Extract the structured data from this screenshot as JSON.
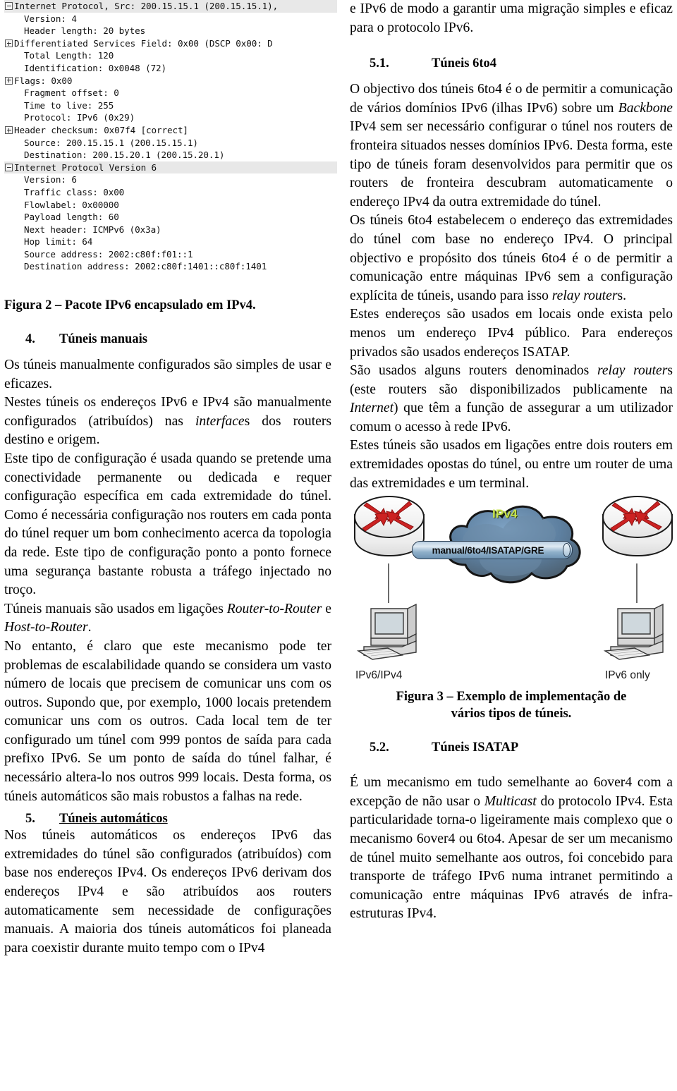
{
  "left_column": {
    "capture_figure": {
      "name": "wireshark-packet-detail",
      "rows": [
        {
          "icon": "minus-box",
          "indent": 0,
          "selected": true,
          "text": "Internet Protocol, Src: 200.15.15.1 (200.15.15.1),"
        },
        {
          "icon": "none",
          "indent": 1,
          "selected": false,
          "text": "Version: 4"
        },
        {
          "icon": "none",
          "indent": 1,
          "selected": false,
          "text": "Header length: 20 bytes"
        },
        {
          "icon": "plus-box",
          "indent": 0,
          "selected": false,
          "text": "Differentiated Services Field: 0x00 (DSCP 0x00: D"
        },
        {
          "icon": "none",
          "indent": 1,
          "selected": false,
          "text": "Total Length: 120"
        },
        {
          "icon": "none",
          "indent": 1,
          "selected": false,
          "text": "Identification: 0x0048 (72)"
        },
        {
          "icon": "plus-box",
          "indent": 0,
          "selected": false,
          "text": "Flags: 0x00"
        },
        {
          "icon": "none",
          "indent": 1,
          "selected": false,
          "text": "Fragment offset: 0"
        },
        {
          "icon": "none",
          "indent": 1,
          "selected": false,
          "text": "Time to live: 255"
        },
        {
          "icon": "none",
          "indent": 1,
          "selected": false,
          "text": "Protocol: IPv6 (0x29)"
        },
        {
          "icon": "plus-box",
          "indent": 0,
          "selected": false,
          "text": "Header checksum: 0x07f4 [correct]"
        },
        {
          "icon": "none",
          "indent": 1,
          "selected": false,
          "text": "Source: 200.15.15.1 (200.15.15.1)"
        },
        {
          "icon": "none",
          "indent": 1,
          "selected": false,
          "text": "Destination: 200.15.20.1 (200.15.20.1)"
        },
        {
          "icon": "minus-box",
          "indent": 0,
          "selected": true,
          "text": "Internet Protocol Version 6"
        },
        {
          "icon": "none",
          "indent": 1,
          "selected": false,
          "text": "Version: 6"
        },
        {
          "icon": "none",
          "indent": 1,
          "selected": false,
          "text": "Traffic class: 0x00"
        },
        {
          "icon": "none",
          "indent": 1,
          "selected": false,
          "text": "Flowlabel: 0x00000"
        },
        {
          "icon": "none",
          "indent": 1,
          "selected": false,
          "text": "Payload length: 60"
        },
        {
          "icon": "none",
          "indent": 1,
          "selected": false,
          "text": "Next header: ICMPv6 (0x3a)"
        },
        {
          "icon": "none",
          "indent": 1,
          "selected": false,
          "text": "Hop limit: 64"
        },
        {
          "icon": "none",
          "indent": 1,
          "selected": false,
          "text": "Source address: 2002:c80f:f01::1"
        },
        {
          "icon": "none",
          "indent": 1,
          "selected": false,
          "text": "Destination address: 2002:c80f:1401::c80f:1401"
        }
      ]
    },
    "figure2_caption": "Figura 2 – Pacote IPv6 encapsulado em IPv4.",
    "section4": {
      "number": "4.",
      "title": "Túneis manuais"
    },
    "p1": "Os túneis manualmente configurados são simples de usar e eficazes.",
    "p2_a": "Nestes túneis os endereços IPv6 e IPv4 são manualmente configurados (atribuídos) nas ",
    "p2_it": "interface",
    "p2_b": "s dos routers destino e origem.",
    "p3": "Este tipo de configuração é usada quando se pretende uma conectividade permanente ou dedicada e requer configuração específica em cada extremidade do túnel. Como é necessária configuração nos routers em cada ponta do túnel requer um bom conhecimento acerca da topologia da rede. Este tipo de configuração ponto a ponto fornece uma segurança bastante robusta a tráfego injectado no troço.",
    "p4_a": "Túneis manuais são usados em ligações ",
    "p4_it1": "Router-to-Router",
    "p4_b": " e ",
    "p4_it2": "Host-to-Router",
    "p4_c": ".",
    "p5": "No entanto, é claro que este mecanismo pode ter problemas de escalabilidade quando se considera um vasto número de locais que precisem de comunicar uns com os outros. Supondo que, por exemplo, 1000 locais pretendem comunicar uns com os outros. Cada local tem de ter configurado um túnel com 999 pontos de saída para cada prefixo IPv6. Se um ponto de saída do túnel falhar, é necessário altera-lo nos outros 999 locais. Desta forma, os túneis automáticos são mais robustos a falhas na rede.",
    "section5": {
      "number": "5.",
      "title": "Túneis automáticos"
    },
    "p6": "Nos túneis automáticos os endereços IPv6 das extremidades do túnel são configurados (atribuídos) com base nos endereços IPv4. Os endereços IPv6 derivam dos endereços IPv4 e são atribuídos aos routers automaticamente sem necessidade de configurações manuais. A maioria dos túneis automáticos foi planeada para coexistir durante muito tempo com o IPv4"
  },
  "right_column": {
    "p_top": "e IPv6 de modo a garantir uma migração simples e eficaz para o protocolo IPv6.",
    "section51": {
      "number": "5.1.",
      "title": "Túneis 6to4"
    },
    "p1_a": "O objectivo dos túneis 6to4 é o de permitir a comunicação de vários domínios IPv6 (ilhas IPv6) sobre um ",
    "p1_it": "Backbone",
    "p1_b": " IPv4 sem ser necessário configurar o túnel nos routers de fronteira situados nesses domínios IPv6. Desta forma, este tipo de túneis foram desenvolvidos para permitir que os routers de fronteira descubram automaticamente o endereço IPv4 da outra extremidade do túnel.",
    "p2_a": "Os túneis 6to4 estabelecem o endereço das extremidades do túnel com base no endereço IPv4. O principal objectivo e propósito dos túneis 6to4 é o de permitir a comunicação entre máquinas IPv6 sem a configuração explícita de túneis, usando para isso ",
    "p2_it": "relay router",
    "p2_b": "s.",
    "p3": "Estes endereços são usados em locais onde exista pelo menos um endereço IPv4 público. Para endereços privados são usados endereços ISATAP.",
    "p4_a": "São usados alguns routers denominados ",
    "p4_it1": "relay router",
    "p4_b": "s (este routers são disponibilizados publicamente na ",
    "p4_it2": "Internet",
    "p4_c": ") que têm a função de assegurar a um utilizador comum o acesso à rede IPv6.",
    "p5": "Estes túneis são usados em ligações entre dois routers em extremidades opostas do túnel, ou entre um router de uma das extremidades e um terminal.",
    "diagram": {
      "name": "tunnel-implementation-diagram",
      "cloud_label": "IPv4",
      "tunnel_label": "manual/6to4/ISATAP/GRE",
      "left_host_label": "IPv6/IPv4",
      "right_host_label": "IPv6 only",
      "cloud_color": "#5b7fa3",
      "cloud_color_dark": "#4a5f73",
      "arrow_color": "#cc2222",
      "ipv4_text_color": "#c8e44a"
    },
    "figure3_caption_line1": "Figura 3 – Exemplo de implementação de",
    "figure3_caption_line2": "vários tipos de túneis.",
    "section52": {
      "number": "5.2.",
      "title": "Túneis ISATAP"
    },
    "p6_a": "É um mecanismo em tudo semelhante ao 6over4 com a excepção de não usar o ",
    "p6_it": "Multicast",
    "p6_b": " do protocolo IPv4. Esta particularidade torna-o ligeiramente mais complexo que o mecanismo 6over4 ou 6to4. Apesar de ser um mecanismo de túnel muito semelhante aos outros, foi concebido para transporte de tráfego IPv6 numa intranet permitindo a comunicação entre máquinas IPv6 através de infra-estruturas IPv4."
  }
}
